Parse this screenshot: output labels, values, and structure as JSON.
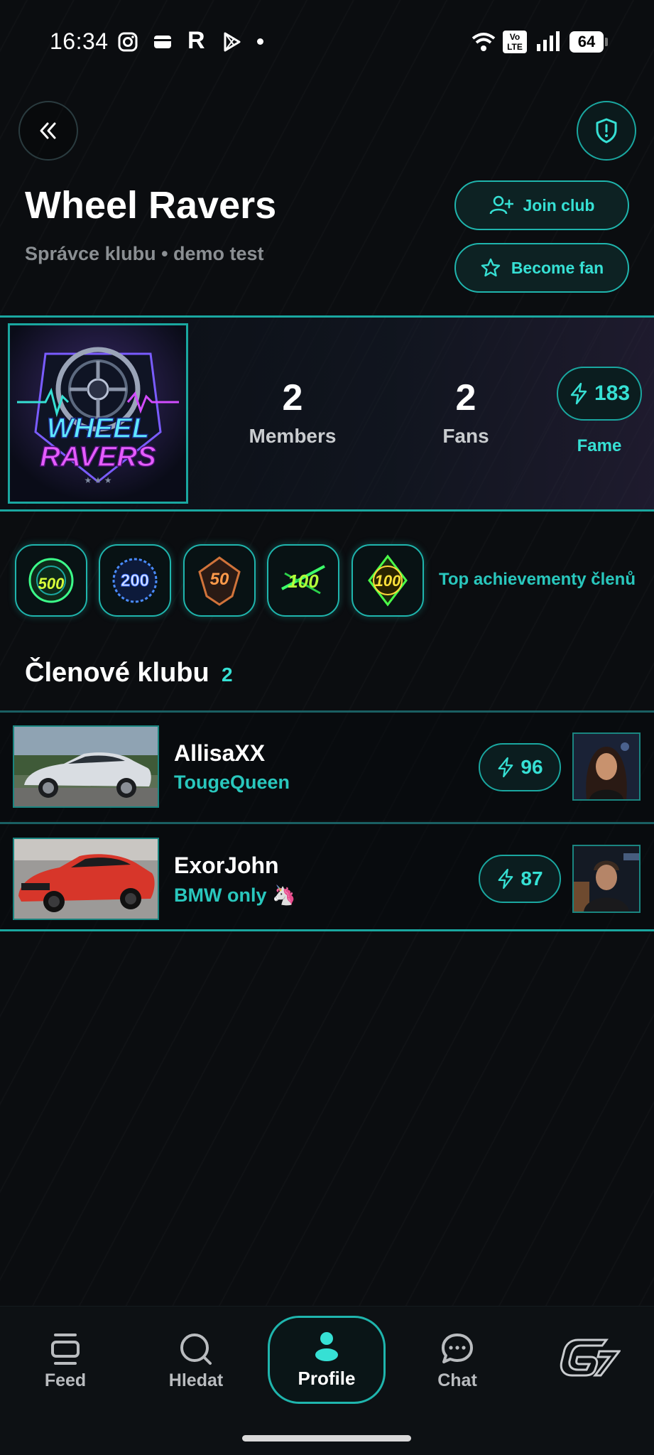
{
  "status_bar": {
    "time": "16:34",
    "battery": "64",
    "volte": "Vo LTE"
  },
  "header": {
    "back_icon": "double-chevron-left-icon",
    "report_icon": "shield-alert-icon"
  },
  "club": {
    "name": "Wheel Ravers",
    "subtitle": "Správce klubu • demo test",
    "logo_text_top": "WHEEL",
    "logo_text_bottom": "RAVERS",
    "join_label": "Join club",
    "fan_label": "Become fan"
  },
  "stats": {
    "members_value": "2",
    "members_label": "Members",
    "fans_value": "2",
    "fans_label": "Fans",
    "fame_value": "183",
    "fame_label": "Fame"
  },
  "achievements": {
    "badges": [
      "500",
      "200",
      "50",
      "100",
      "100"
    ],
    "label": "Top achievementy členů"
  },
  "members": {
    "title": "Členové klubu",
    "count": "2",
    "list": [
      {
        "name": "AllisaXX",
        "tag": "TougeQueen",
        "score": "96"
      },
      {
        "name": "ExorJohn",
        "tag": "BMW only 🦄",
        "score": "87"
      }
    ]
  },
  "nav": {
    "feed": "Feed",
    "search": "Hledat",
    "profile": "Profile",
    "chat": "Chat"
  },
  "colors": {
    "accent": "#1fb5ad",
    "accent_text": "#36e0d4",
    "background": "#0b0d10"
  }
}
